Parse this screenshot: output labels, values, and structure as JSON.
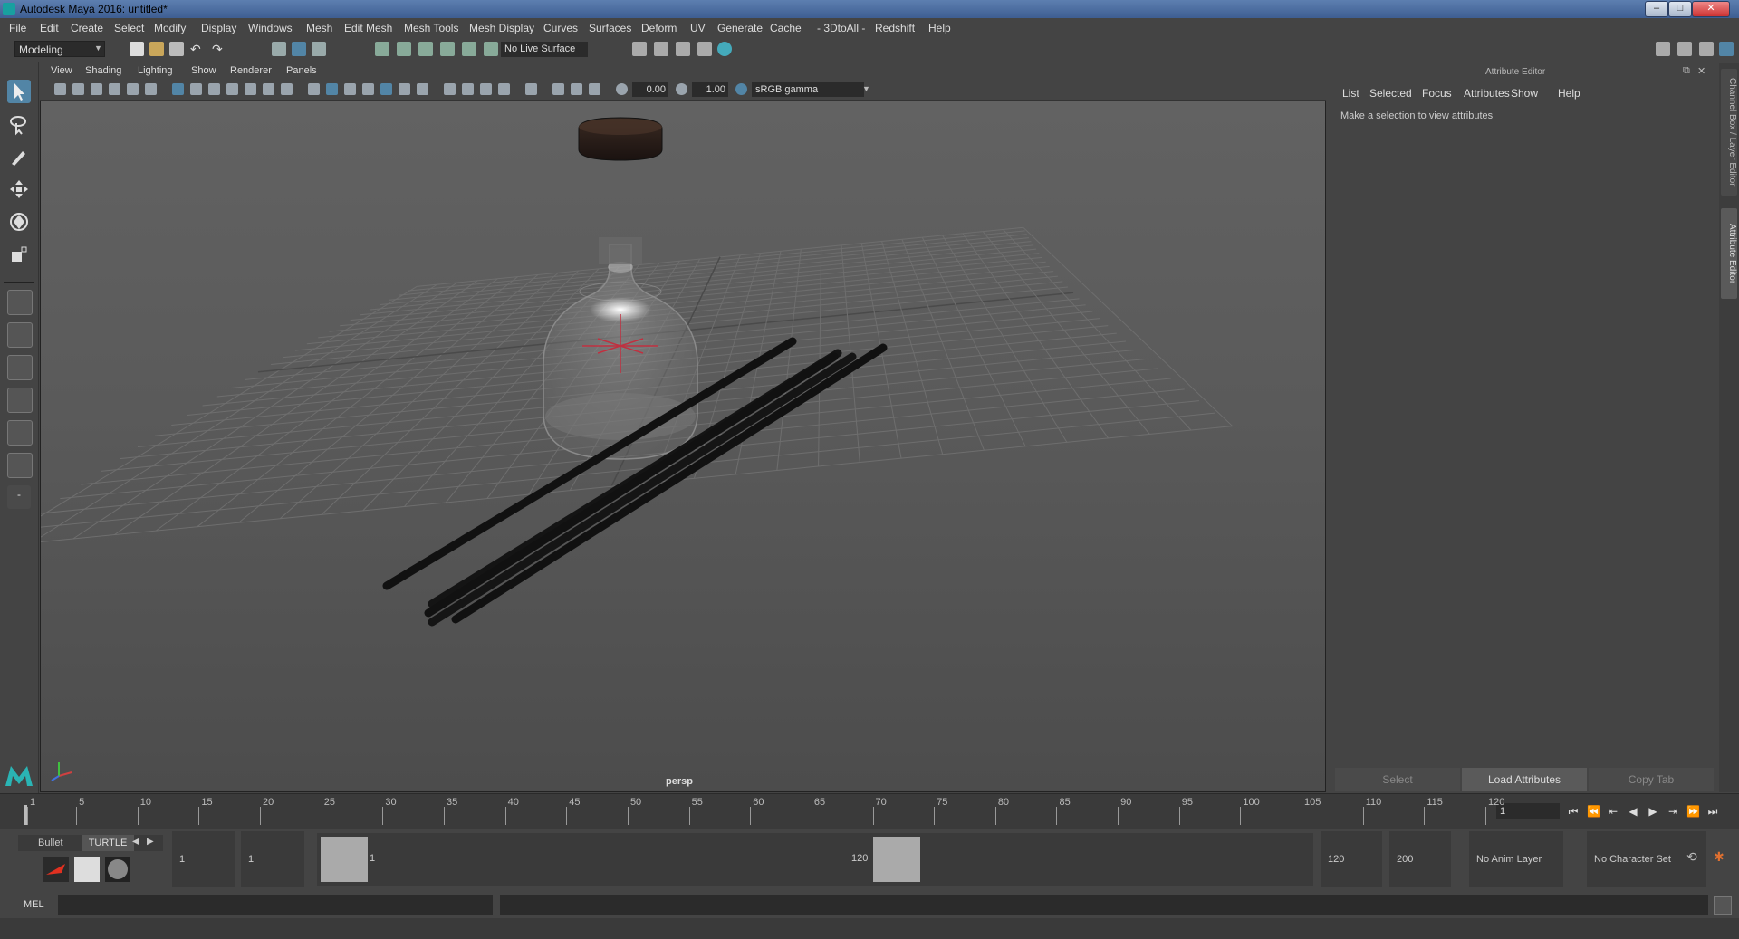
{
  "app": {
    "title": "Autodesk Maya 2016: untitled*",
    "window_controls": {
      "minimize": "–",
      "maximize": "□",
      "close": "✕"
    }
  },
  "menubar": {
    "items": [
      "File",
      "Edit",
      "Create",
      "Select",
      "Modify",
      "Display",
      "Windows",
      "Mesh",
      "Edit Mesh",
      "Mesh Tools",
      "Mesh Display",
      "Curves",
      "Surfaces",
      "Deform",
      "UV",
      "Generate",
      "Cache",
      "- 3DtoAll -",
      "Redshift",
      "Help"
    ]
  },
  "statusline": {
    "mode": "Modeling",
    "live_surface": "No Live Surface"
  },
  "panel": {
    "menu": [
      "View",
      "Shading",
      "Lighting",
      "Show",
      "Renderer",
      "Panels"
    ],
    "exposure": "0.00",
    "gamma": "1.00",
    "color_space": "sRGB gamma",
    "camera_label": "persp"
  },
  "attribute_editor": {
    "header": "Attribute Editor",
    "menu": [
      "List",
      "Selected",
      "Focus",
      "Attributes",
      "Show",
      "Help"
    ],
    "message": "Make a selection to view attributes",
    "buttons": {
      "select": "Select",
      "load": "Load Attributes",
      "copy": "Copy Tab"
    },
    "side_tabs": [
      "Channel Box / Layer Editor",
      "Attribute Editor"
    ]
  },
  "timeslider": {
    "ticks": [
      "1",
      "5",
      "10",
      "15",
      "20",
      "25",
      "30",
      "35",
      "40",
      "45",
      "50",
      "55",
      "60",
      "65",
      "70",
      "75",
      "80",
      "85",
      "90",
      "95",
      "100",
      "105",
      "110",
      "115",
      "120"
    ],
    "current_frame": "1"
  },
  "range": {
    "shelf_tabs": [
      "Bullet",
      "TURTLE"
    ],
    "start": "1",
    "playback_start": "1",
    "slider_min": "1",
    "slider_max": "120",
    "playback_end": "120",
    "end": "200",
    "anim_layer": "No Anim Layer",
    "character_set": "No Character Set"
  },
  "cmdline": {
    "label": "MEL"
  },
  "colors": {
    "accent": "#5285a6",
    "viewport_bg": "#5c5c5c",
    "ui_bg": "#444444"
  }
}
